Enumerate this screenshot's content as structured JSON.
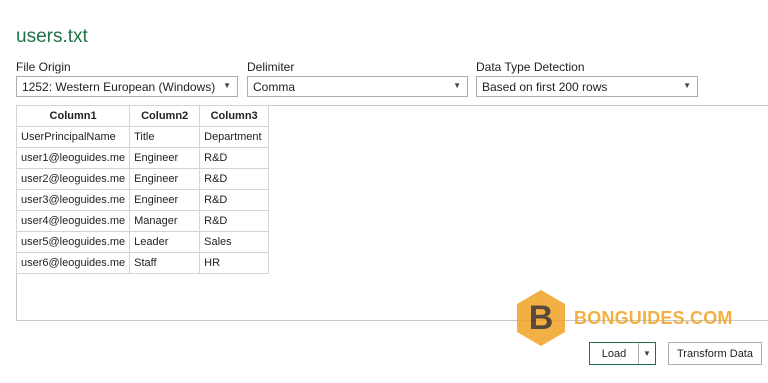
{
  "file_name": "users.txt",
  "options": {
    "file_origin": {
      "label": "File Origin",
      "value": "1252: Western European (Windows)"
    },
    "delimiter": {
      "label": "Delimiter",
      "value": "Comma"
    },
    "data_type_detection": {
      "label": "Data Type Detection",
      "value": "Based on first 200 rows"
    }
  },
  "table": {
    "headers": [
      "Column1",
      "Column2",
      "Column3"
    ],
    "rows": [
      [
        "UserPrincipalName",
        "Title",
        "Department"
      ],
      [
        "user1@leoguides.me",
        "Engineer",
        "R&D"
      ],
      [
        "user2@leoguides.me",
        "Engineer",
        "R&D"
      ],
      [
        "user3@leoguides.me",
        "Engineer",
        "R&D"
      ],
      [
        "user4@leoguides.me",
        "Manager",
        "R&D"
      ],
      [
        "user5@leoguides.me",
        "Leader",
        "Sales"
      ],
      [
        "user6@leoguides.me",
        "Staff",
        "HR"
      ]
    ]
  },
  "watermark": {
    "text": "BONGUIDES.COM",
    "icon": "b-hexagon-logo"
  },
  "buttons": {
    "load": "Load",
    "transform": "Transform Data"
  },
  "colors": {
    "title": "#217346",
    "accent_border": "#217346",
    "watermark": "#f0a224"
  }
}
